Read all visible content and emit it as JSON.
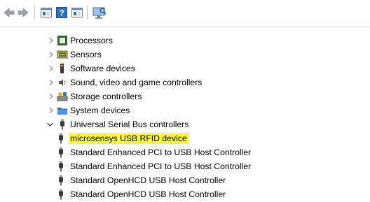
{
  "toolbar": {
    "icons": [
      "back-arrow-icon",
      "forward-arrow-icon",
      "properties-icon",
      "help-icon",
      "update-driver-icon",
      "scan-hardware-icon"
    ]
  },
  "tree": {
    "categories": [
      {
        "label": "Processors",
        "icon": "processor-icon",
        "expanded": false
      },
      {
        "label": "Sensors",
        "icon": "sensor-icon",
        "expanded": false
      },
      {
        "label": "Software devices",
        "icon": "software-device-icon",
        "expanded": false
      },
      {
        "label": "Sound, video and game controllers",
        "icon": "speaker-icon",
        "expanded": false
      },
      {
        "label": "Storage controllers",
        "icon": "storage-controller-icon",
        "expanded": false
      },
      {
        "label": "System devices",
        "icon": "system-folder-icon",
        "expanded": false
      },
      {
        "label": "Universal Serial Bus controllers",
        "icon": "usb-plug-icon",
        "expanded": true
      }
    ],
    "usb_children": [
      {
        "label": "microsensys USB RFID device",
        "highlight": "#ffff33"
      },
      {
        "label": "Standard Enhanced PCI to USB Host Controller"
      },
      {
        "label": "Standard Enhanced PCI to USB Host Controller"
      },
      {
        "label": "Standard OpenHCD USB Host Controller"
      },
      {
        "label": "Standard OpenHCD USB Host Controller"
      }
    ]
  }
}
